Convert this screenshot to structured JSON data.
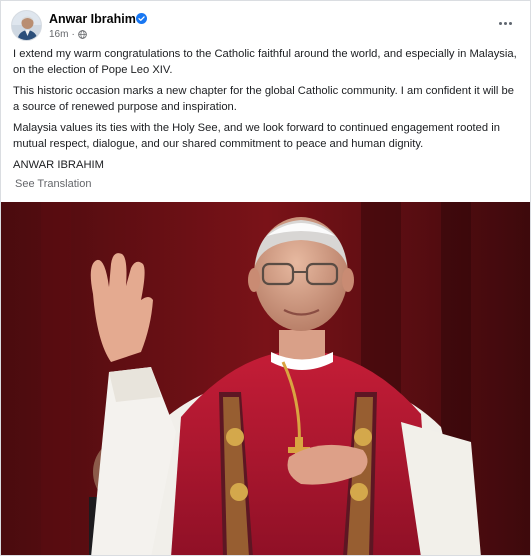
{
  "post": {
    "author_name": "Anwar Ibrahim",
    "timestamp": "16m",
    "meta_separator": "·",
    "paragraphs": [
      "I extend my warm congratulations to the Catholic faithful around the world, and especially in Malaysia, on the election of Pope Leo XIV.",
      "This historic occasion marks a new chapter for the global Catholic community. I am confident it will be a source of renewed purpose and inspiration.",
      "Malaysia values its ties with the Holy See, and we look forward to continued engagement rooted in mutual respect, dialogue, and our shared commitment to peace and human dignity.",
      "ANWAR IBRAHIM"
    ],
    "see_translation_label": "See Translation"
  },
  "icons": {
    "verified": "verified-badge-icon",
    "privacy": "globe-icon",
    "more": "more-options-icon"
  },
  "colors": {
    "verified_blue": "#1877f2",
    "meta_gray": "#65676b",
    "photo_red": "#7a1218"
  }
}
